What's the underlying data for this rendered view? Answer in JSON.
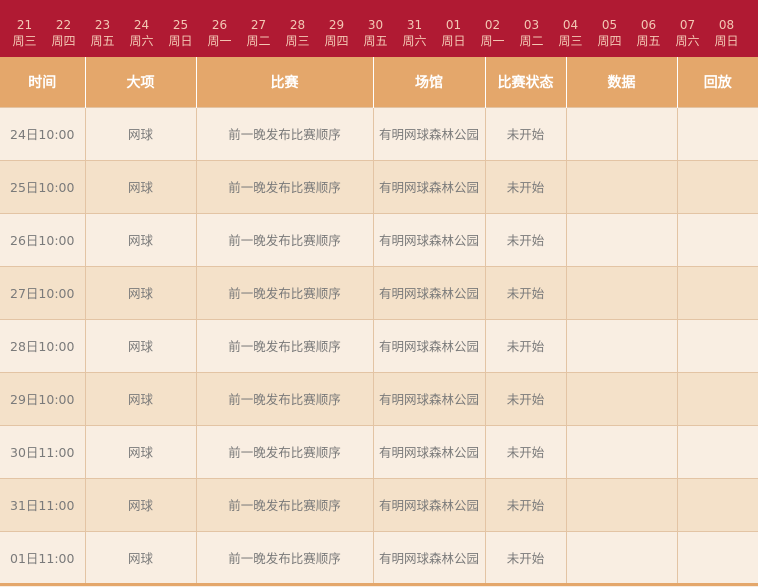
{
  "date_bar": [
    {
      "day": "21",
      "weekday": "周三"
    },
    {
      "day": "22",
      "weekday": "周四"
    },
    {
      "day": "23",
      "weekday": "周五"
    },
    {
      "day": "24",
      "weekday": "周六"
    },
    {
      "day": "25",
      "weekday": "周日"
    },
    {
      "day": "26",
      "weekday": "周一"
    },
    {
      "day": "27",
      "weekday": "周二"
    },
    {
      "day": "28",
      "weekday": "周三"
    },
    {
      "day": "29",
      "weekday": "周四"
    },
    {
      "day": "30",
      "weekday": "周五"
    },
    {
      "day": "31",
      "weekday": "周六"
    },
    {
      "day": "01",
      "weekday": "周日"
    },
    {
      "day": "02",
      "weekday": "周一"
    },
    {
      "day": "03",
      "weekday": "周二"
    },
    {
      "day": "04",
      "weekday": "周三"
    },
    {
      "day": "05",
      "weekday": "周四"
    },
    {
      "day": "06",
      "weekday": "周五"
    },
    {
      "day": "07",
      "weekday": "周六"
    },
    {
      "day": "08",
      "weekday": "周日"
    }
  ],
  "table": {
    "headers": [
      "时间",
      "大项",
      "比赛",
      "场馆",
      "比赛状态",
      "数据",
      "回放"
    ],
    "rows": [
      [
        "24日10:00",
        "网球",
        "前一晚发布比赛顺序",
        "有明网球森林公园",
        "未开始",
        "",
        ""
      ],
      [
        "25日10:00",
        "网球",
        "前一晚发布比赛顺序",
        "有明网球森林公园",
        "未开始",
        "",
        ""
      ],
      [
        "26日10:00",
        "网球",
        "前一晚发布比赛顺序",
        "有明网球森林公园",
        "未开始",
        "",
        ""
      ],
      [
        "27日10:00",
        "网球",
        "前一晚发布比赛顺序",
        "有明网球森林公园",
        "未开始",
        "",
        ""
      ],
      [
        "28日10:00",
        "网球",
        "前一晚发布比赛顺序",
        "有明网球森林公园",
        "未开始",
        "",
        ""
      ],
      [
        "29日10:00",
        "网球",
        "前一晚发布比赛顺序",
        "有明网球森林公园",
        "未开始",
        "",
        ""
      ],
      [
        "30日11:00",
        "网球",
        "前一晚发布比赛顺序",
        "有明网球森林公园",
        "未开始",
        "",
        ""
      ],
      [
        "31日11:00",
        "网球",
        "前一晚发布比赛顺序",
        "有明网球森林公园",
        "未开始",
        "",
        ""
      ],
      [
        "01日11:00",
        "网球",
        "前一晚发布比赛顺序",
        "有明网球森林公园",
        "未开始",
        "",
        ""
      ]
    ]
  }
}
